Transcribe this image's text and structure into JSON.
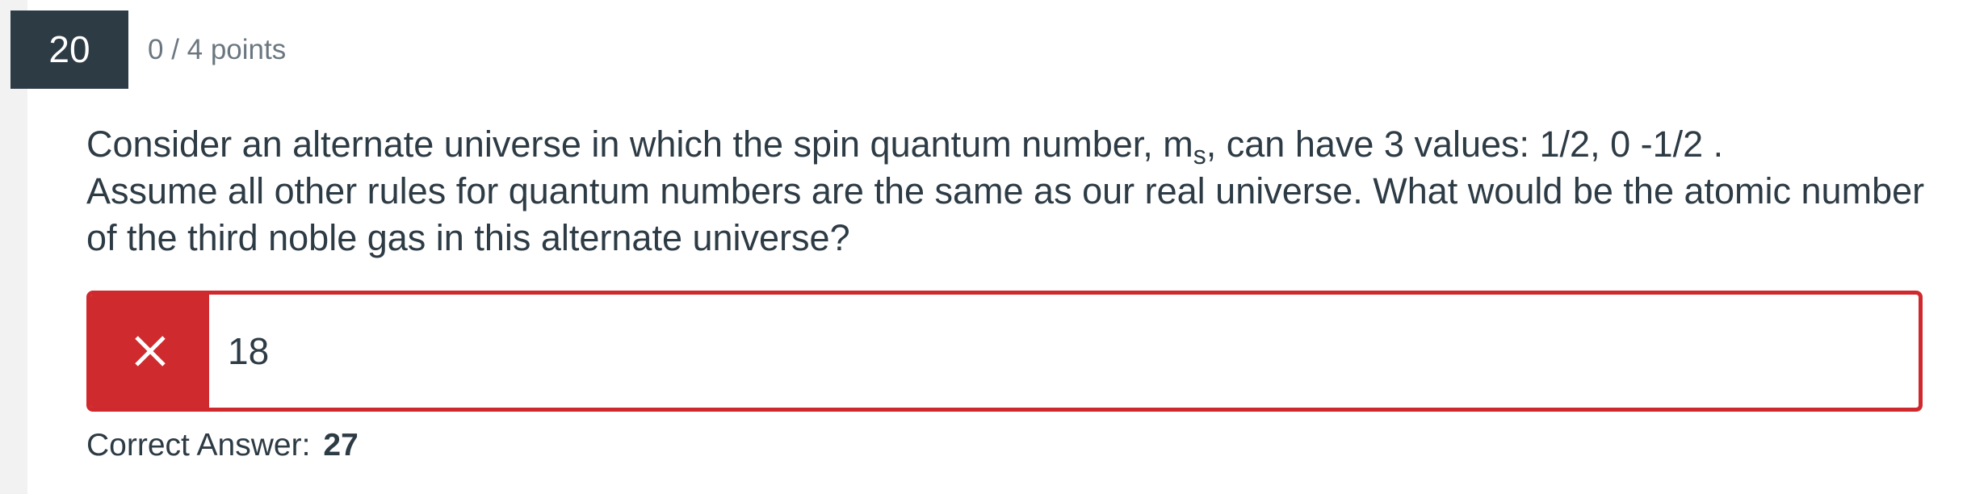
{
  "question": {
    "number": "20",
    "points": "0 / 4 points",
    "text_line1_pre": "Consider an alternate universe in which the spin quantum number, m",
    "text_line1_sub": "s",
    "text_line1_post": ", can have 3 values:  1/2, 0 -1/2 .",
    "text_line2": " Assume all other rules for quantum numbers are the same as our real universe.  What would be the atomic number of the third noble gas in this alternate universe?"
  },
  "answer": {
    "value": "18",
    "status": "incorrect",
    "status_icon": "close-icon",
    "status_color": "#cf2a2d"
  },
  "correct": {
    "label": "Correct Answer:",
    "value": "27"
  }
}
